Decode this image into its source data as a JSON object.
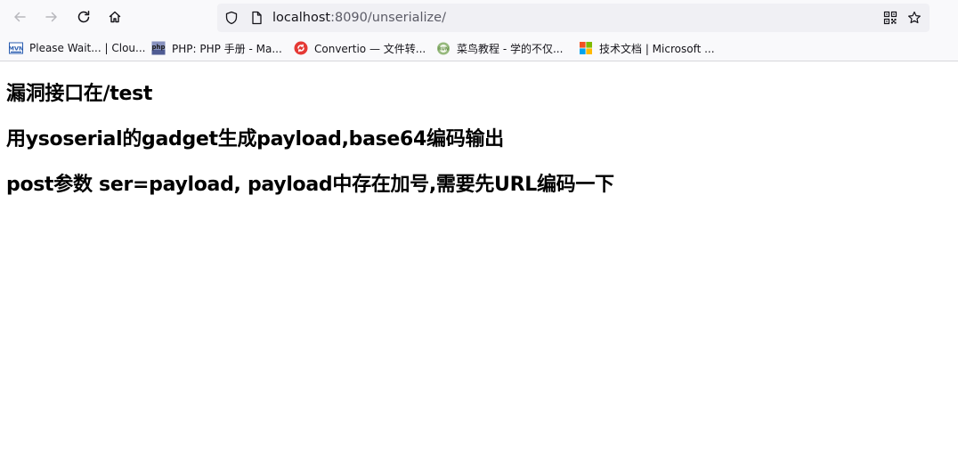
{
  "browser": {
    "url": {
      "host": "localhost",
      "rest": ":8090/unserialize/"
    },
    "bookmarks": [
      {
        "label": "Please Wait... | Clou...",
        "icon": "mvn-icon"
      },
      {
        "label": "PHP: PHP 手册 - Ma...",
        "icon": "php-icon"
      },
      {
        "label": "Convertio — 文件转...",
        "icon": "convertio-icon"
      },
      {
        "label": "菜鸟教程 - 学的不仅...",
        "icon": "runoob-icon"
      },
      {
        "label": "技术文档 | Microsoft ...",
        "icon": "microsoft-icon"
      }
    ]
  },
  "page": {
    "lines": [
      "漏洞接口在/test",
      "用ysoserial的gadget生成payload,base64编码输出",
      "post参数 ser=payload, payload中存在加号,需要先URL编码一下"
    ]
  },
  "colors": {
    "toolbar_bg": "#f9f9fb",
    "urlbar_bg": "#f0f0f4",
    "text": "#000000"
  }
}
